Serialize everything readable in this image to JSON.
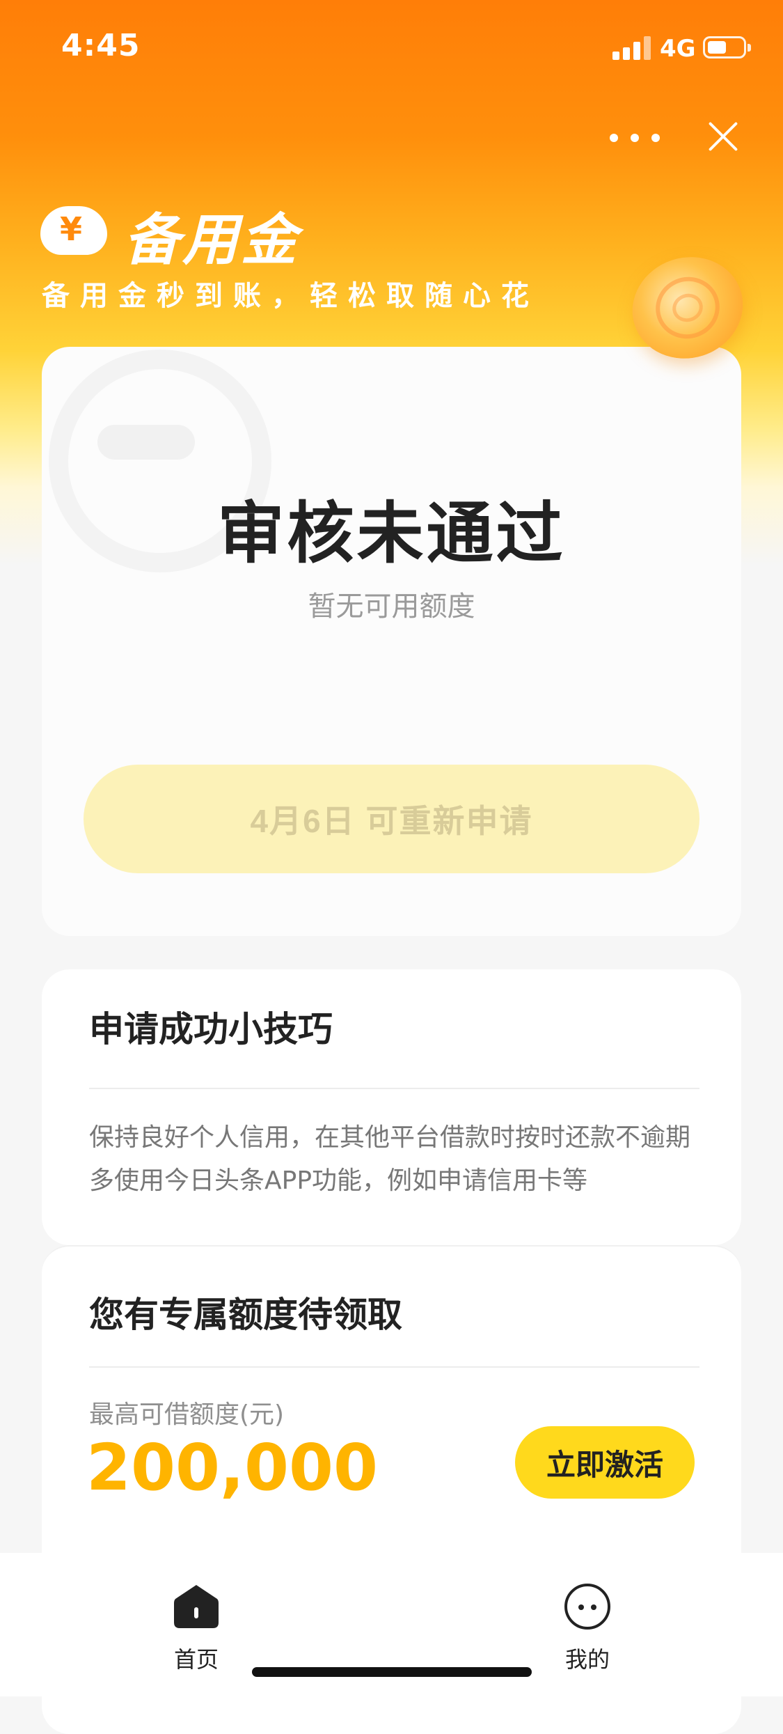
{
  "status_bar": {
    "time": "4:45",
    "network": "4G"
  },
  "header": {
    "more_icon": "more-horizontal-icon",
    "close_icon": "close-icon",
    "brand_name": "备用金",
    "brand_logo_icon": "yen-cloud-icon",
    "slogan": "备用金秒到账，轻松取随心花"
  },
  "status_card": {
    "title": "审核未通过",
    "subtitle": "暂无可用额度",
    "reapply_button": "4月6日 可重新申请"
  },
  "tips_card": {
    "title": "申请成功小技巧",
    "tips": [
      "保持良好个人信用，在其他平台借款时按时还款不逾期",
      "多使用今日头条APP功能，例如申请信用卡等"
    ]
  },
  "quota_card": {
    "title": "您有专属额度待领取",
    "label": "最高可借额度(元)",
    "amount": "200,000",
    "activate_button": "立即激活"
  },
  "tab_bar": {
    "items": [
      {
        "label": "首页",
        "icon": "home-icon",
        "active": true
      },
      {
        "label": "我的",
        "icon": "profile-face-icon",
        "active": false
      }
    ]
  },
  "colors": {
    "brand_orange": "#ff7e08",
    "amount_yellow": "#ffb400",
    "button_yellow": "#ffd91c"
  }
}
